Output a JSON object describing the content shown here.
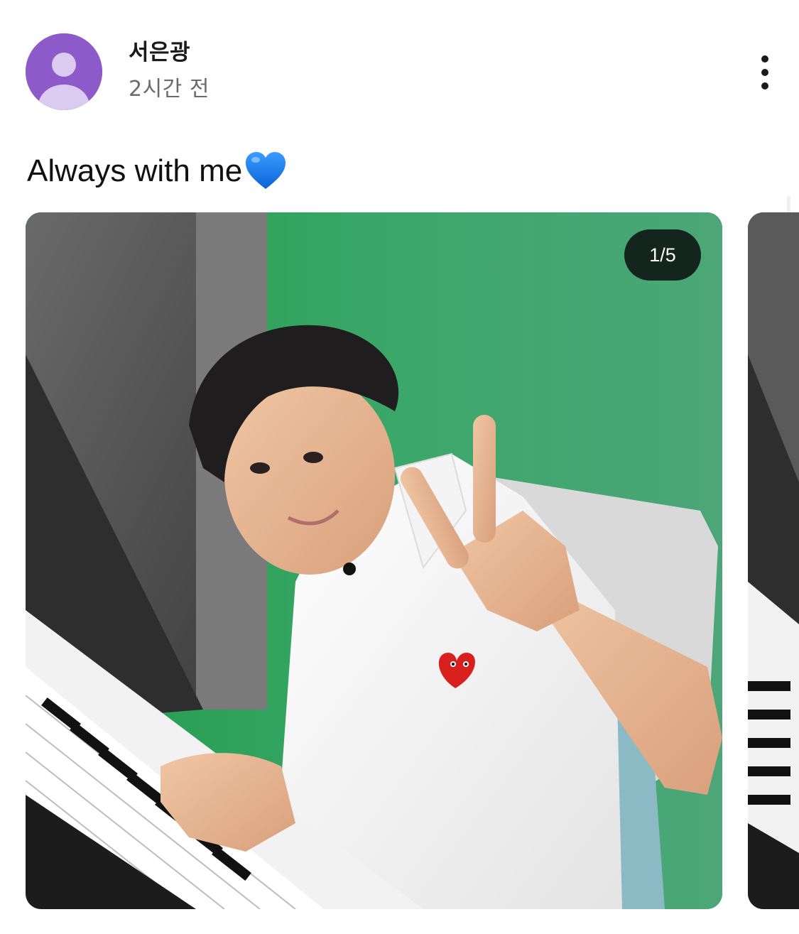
{
  "post": {
    "author": {
      "name": "서은광",
      "avatar_icon": "default-user-avatar-icon",
      "avatar_color": "#8d5ac9"
    },
    "time": "2시간 전",
    "more_icon": "vertical-ellipsis-icon",
    "caption": {
      "text": "Always with me",
      "emoji": "blue-heart-emoji",
      "emoji_color": "#1a7ef0"
    },
    "carousel": {
      "counter": "1/5",
      "current": 1,
      "total": 5
    }
  }
}
